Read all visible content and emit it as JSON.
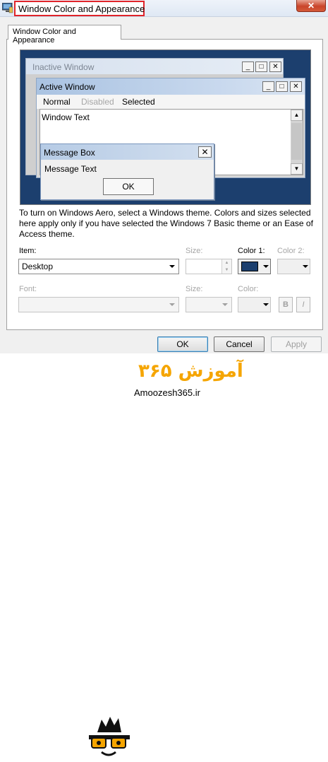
{
  "window": {
    "title": "Window Color and Appearance",
    "close_symbol": "✕"
  },
  "tab": {
    "label": "Window Color and Appearance"
  },
  "preview": {
    "inactive_title": "Inactive Window",
    "active_title": "Active Window",
    "menu": {
      "normal": "Normal",
      "disabled": "Disabled",
      "selected": "Selected"
    },
    "window_text": "Window Text",
    "message_box_title": "Message Box",
    "message_text": "Message Text",
    "ok_label": "OK",
    "background_color": "#1c3f6e"
  },
  "help_text": "To turn on Windows Aero, select a Windows theme.  Colors and sizes selected here apply only if you have selected the Windows 7 Basic theme or an Ease of Access theme.",
  "item_row": {
    "item_label": "Item:",
    "item_value": "Desktop",
    "size_label": "Size:",
    "size_value": "",
    "color1_label": "Color 1:",
    "color1_value": "#1c3f6e",
    "color2_label": "Color 2:"
  },
  "font_row": {
    "font_label": "Font:",
    "size_label": "Size:",
    "color_label": "Color:",
    "bold_label": "B",
    "italic_label": "I"
  },
  "buttons": {
    "ok": "OK",
    "cancel": "Cancel",
    "apply": "Apply"
  },
  "footer": {
    "brand": "آموزش ۳۶۵",
    "site": "Amoozesh365.ir"
  }
}
